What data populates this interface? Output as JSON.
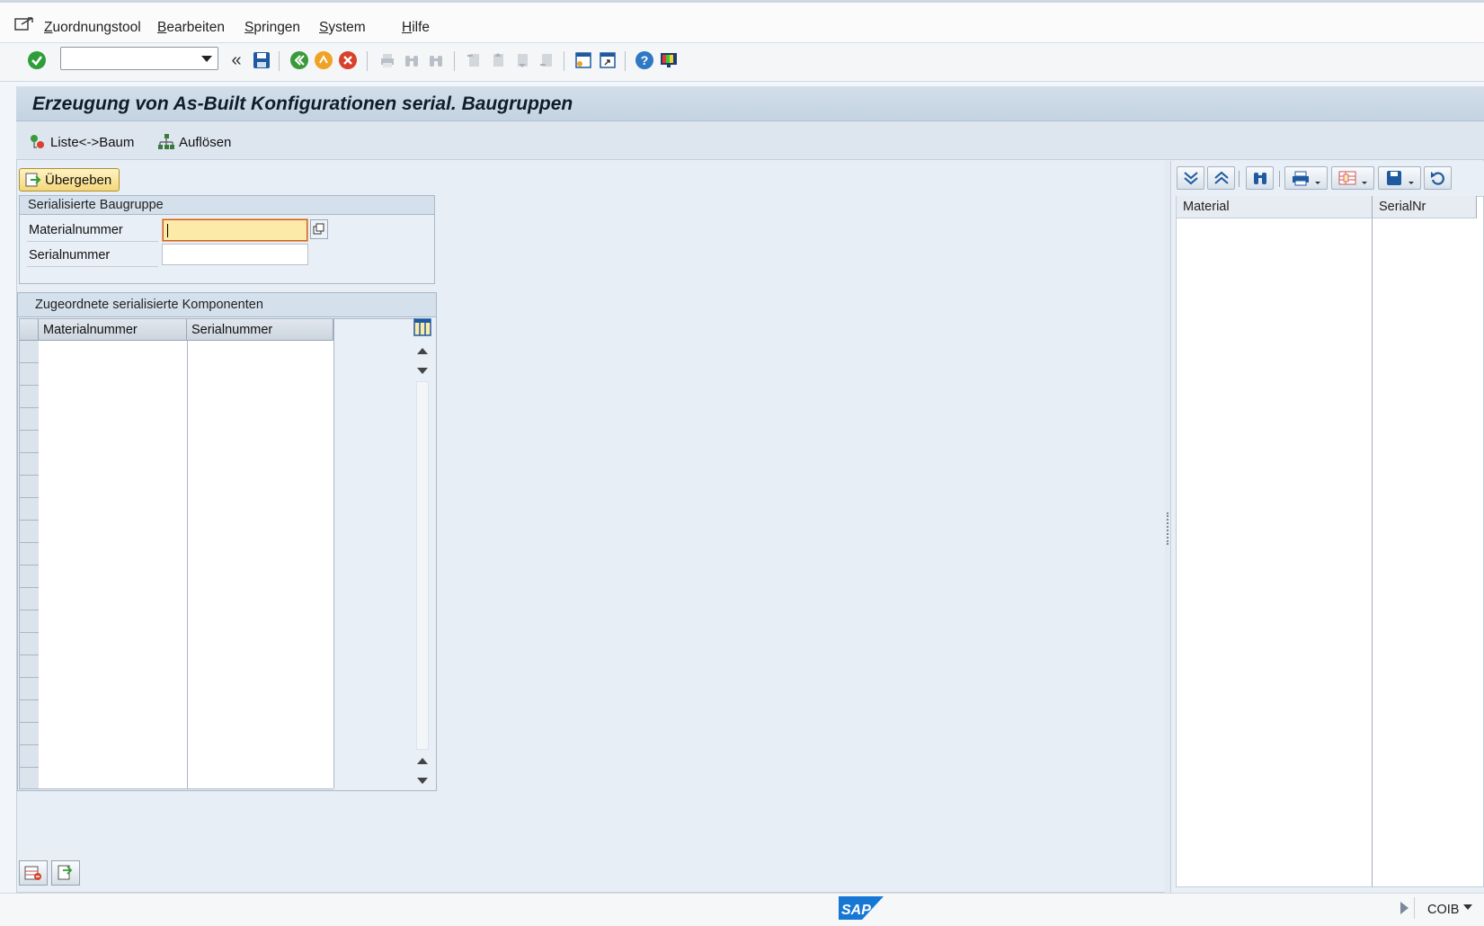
{
  "menubar": {
    "items": [
      {
        "label": "Zuordnungstool",
        "underline": "Z",
        "rest": "uordnungstool"
      },
      {
        "label": "Bearbeiten",
        "underline": "B",
        "rest": "earbeiten"
      },
      {
        "label": "Springen",
        "underline": "S",
        "rest": "pringen"
      },
      {
        "label": "System",
        "underline": "S",
        "rest": "ystem"
      },
      {
        "label": "Hilfe",
        "underline": "H",
        "rest": "ilfe"
      }
    ]
  },
  "toolbar": {
    "command_field_value": "",
    "back_glyph": "«"
  },
  "screen": {
    "title": "Erzeugung von As-Built Konfigurationen serial. Baugruppen"
  },
  "app_toolbar": {
    "liste_baum_label": "Liste<->Baum",
    "aufloesen_label": "Auflösen"
  },
  "left": {
    "uebergeben_label": "Übergeben",
    "group1": {
      "title": "Serialisierte Baugruppe",
      "material_label": "Materialnummer",
      "material_value": "",
      "serial_label": "Serialnummer",
      "serial_value": ""
    },
    "group2": {
      "title": "Zugeordnete serialisierte Komponenten",
      "columns": [
        "Materialnummer",
        "Serialnummer"
      ],
      "rows": []
    }
  },
  "right": {
    "columns": [
      "Material",
      "SerialNr"
    ],
    "rows": []
  },
  "statusbar": {
    "logo_text": "SAP",
    "transaction": "COIB"
  },
  "colors": {
    "accent_yellow": "#fbeaa8",
    "title_bg": "#c9d7e5",
    "ok_green": "#2e9e3a",
    "cancel_red": "#d9412b"
  }
}
